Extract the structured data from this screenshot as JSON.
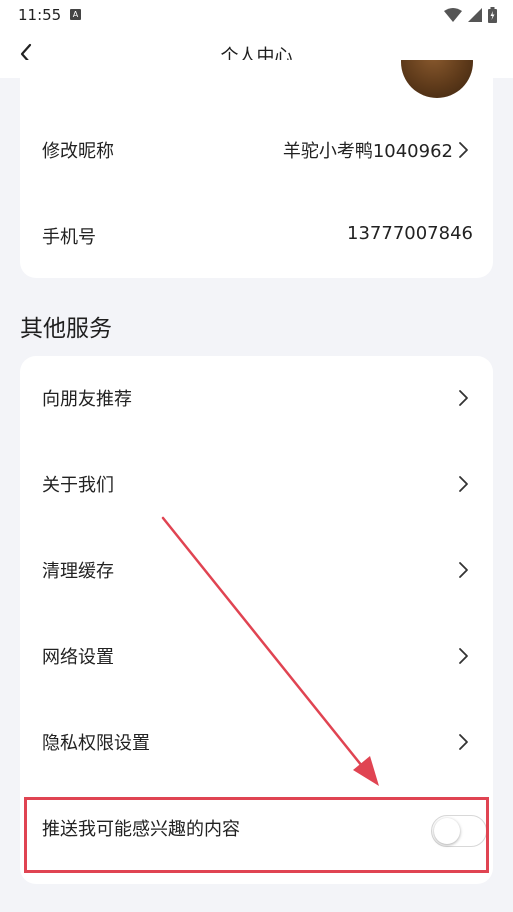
{
  "status_bar": {
    "time": "11:55",
    "notification_icon": "A"
  },
  "nav": {
    "title": "个人中心",
    "back_icon": "chevron-left-icon"
  },
  "profile": {
    "items": [
      {
        "label": "修改昵称",
        "value": "羊驼小考鸭1040962",
        "has_chevron": true
      },
      {
        "label": "手机号",
        "value": "13777007846",
        "has_chevron": false
      }
    ]
  },
  "services": {
    "title": "其他服务",
    "items": [
      {
        "label": "向朋友推荐"
      },
      {
        "label": "关于我们"
      },
      {
        "label": "清理缓存"
      },
      {
        "label": "网络设置"
      },
      {
        "label": "隐私权限设置"
      }
    ],
    "toggle_item": {
      "label": "推送我可能感兴趣的内容",
      "enabled": false
    }
  },
  "colors": {
    "background": "#f3f4f8",
    "card": "#ffffff",
    "annotation": "#e04452"
  }
}
